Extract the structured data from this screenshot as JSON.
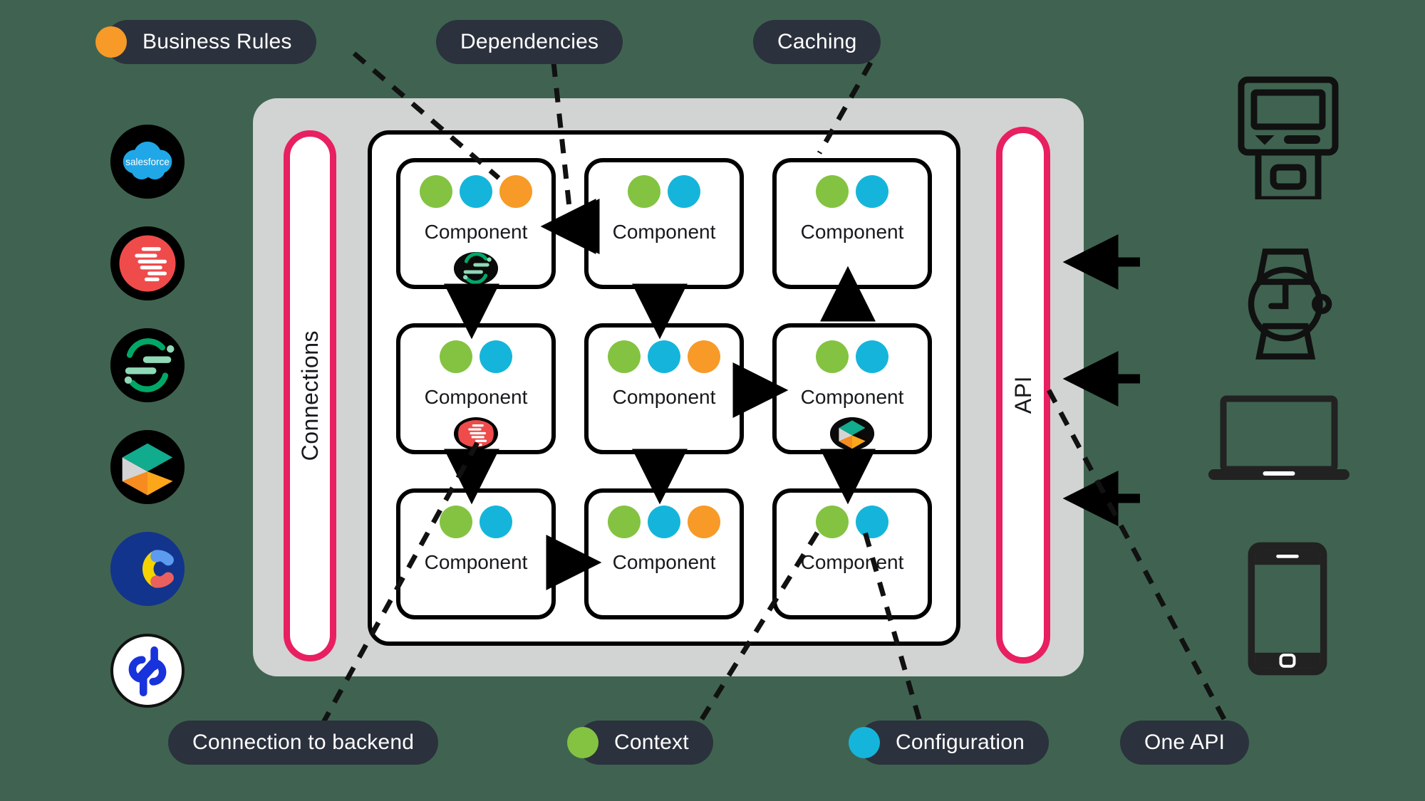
{
  "canvas": {
    "background": "#3f6350"
  },
  "colors": {
    "context_green": "#84c341",
    "configuration_cyan": "#15b5db",
    "business_rules_orange": "#f79a28",
    "pill_dark": "#2b313d",
    "accent_pink": "#e81f60",
    "container_gray": "#d2d3d3",
    "outline_black": "#000000"
  },
  "callouts": {
    "business_rules": {
      "label": "Business Rules",
      "dot_color": "#f79a28"
    },
    "dependencies": {
      "label": "Dependencies"
    },
    "caching": {
      "label": "Caching"
    },
    "connection_to_backend": {
      "label": "Connection to backend"
    },
    "context": {
      "label": "Context",
      "dot_color": "#84c341"
    },
    "configuration": {
      "label": "Configuration",
      "dot_color": "#15b5db"
    },
    "one_api": {
      "label": "One API"
    }
  },
  "lanes": {
    "connections": {
      "label": "Connections"
    },
    "api": {
      "label": "API"
    }
  },
  "grid": {
    "label": "Component",
    "cards": [
      {
        "id": "r1c1",
        "label": "Component",
        "dots": [
          "#84c341",
          "#15b5db",
          "#f79a28"
        ],
        "badge": "sitecore-s-logo"
      },
      {
        "id": "r1c2",
        "label": "Component",
        "dots": [
          "#84c341",
          "#15b5db"
        ],
        "badge": null
      },
      {
        "id": "r1c3",
        "label": "Component",
        "dots": [
          "#84c341",
          "#15b5db"
        ],
        "badge": null
      },
      {
        "id": "r2c1",
        "label": "Component",
        "dots": [
          "#84c341",
          "#15b5db"
        ],
        "badge": "sap-red-logo"
      },
      {
        "id": "r2c2",
        "label": "Component",
        "dots": [
          "#84c341",
          "#15b5db",
          "#f79a28"
        ],
        "badge": null
      },
      {
        "id": "r2c3",
        "label": "Component",
        "dots": [
          "#84c341",
          "#15b5db"
        ],
        "badge": "cube-logo"
      },
      {
        "id": "r3c1",
        "label": "Component",
        "dots": [
          "#84c341",
          "#15b5db"
        ],
        "badge": null
      },
      {
        "id": "r3c2",
        "label": "Component",
        "dots": [
          "#84c341",
          "#15b5db",
          "#f79a28"
        ],
        "badge": null
      },
      {
        "id": "r3c3",
        "label": "Component",
        "dots": [
          "#84c341",
          "#15b5db"
        ],
        "badge": null
      }
    ]
  },
  "connectors": [
    {
      "name": "salesforce-logo"
    },
    {
      "name": "sap-logo"
    },
    {
      "name": "sitecore-logo"
    },
    {
      "name": "cube-logo"
    },
    {
      "name": "contentful-logo"
    },
    {
      "name": "commerce-loops-logo"
    }
  ],
  "devices": [
    {
      "name": "kiosk-icon"
    },
    {
      "name": "smartwatch-icon"
    },
    {
      "name": "laptop-icon"
    },
    {
      "name": "smartphone-icon"
    }
  ]
}
